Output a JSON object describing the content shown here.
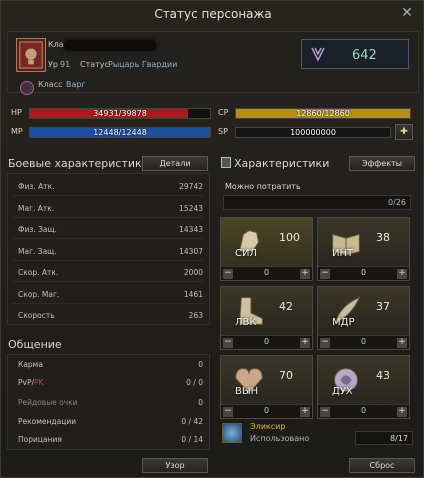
{
  "window": {
    "title": "Статус персонажа"
  },
  "character": {
    "clan_label": "Клан",
    "level_label": "Ур",
    "level": "91",
    "status_label": "Статус",
    "status_value": "Рыцарь Гвардии",
    "class_label": "Класс",
    "class_value": "Варг",
    "power": "642"
  },
  "bars": {
    "hp": {
      "label": "HP",
      "text": "34931/39878",
      "fraction": 0.876,
      "color": "#a41d1d"
    },
    "mp": {
      "label": "MP",
      "text": "12448/12448",
      "fraction": 1.0,
      "color": "#1e4e9e"
    },
    "cp": {
      "label": "CP",
      "text": "12860/12860",
      "fraction": 1.0,
      "color": "#b48d1a"
    },
    "sp": {
      "label": "SP",
      "text": "100000000"
    }
  },
  "combat": {
    "title": "Боевые характеристики",
    "details_button": "Детали",
    "rows": [
      {
        "label": "Физ. Атк.",
        "value": "29742"
      },
      {
        "label": "Маг. Атк.",
        "value": "15243"
      },
      {
        "label": "Физ. Защ.",
        "value": "14343"
      },
      {
        "label": "Маг. Защ.",
        "value": "14307"
      },
      {
        "label": "Скор. Атк.",
        "value": "2000"
      },
      {
        "label": "Скор. Маг.",
        "value": "1461"
      },
      {
        "label": "Скорость",
        "value": "263"
      }
    ]
  },
  "social": {
    "title": "Общение",
    "karma_label": "Карма",
    "karma_value": "0",
    "pvp_label": "PvP/",
    "pk_label": "PK",
    "pvp_value": "0 / 0",
    "raid_label": "Рейдовые очки",
    "raid_value": "0",
    "rec_label": "Рекомендации",
    "rec_value": "0 / 42",
    "cens_label": "Порицания",
    "cens_value": "0 / 14",
    "view_button": "Узор"
  },
  "attributes": {
    "title": "Характеристики",
    "effects_button": "Эффекты",
    "spend_label": "Можно потратить",
    "spend_value": "0/26",
    "stats": [
      {
        "abbr": "СИЛ",
        "value": "100",
        "alloc": "0",
        "icon": "fist-icon"
      },
      {
        "abbr": "ИНТ",
        "value": "38",
        "alloc": "0",
        "icon": "book-icon"
      },
      {
        "abbr": "ЛВК",
        "value": "42",
        "alloc": "0",
        "icon": "boot-icon"
      },
      {
        "abbr": "МДР",
        "value": "37",
        "alloc": "0",
        "icon": "feather-icon"
      },
      {
        "abbr": "ВЫН",
        "value": "70",
        "alloc": "0",
        "icon": "heart-icon"
      },
      {
        "abbr": "ДУХ",
        "value": "43",
        "alloc": "0",
        "icon": "spirit-icon"
      }
    ],
    "elixir_label": "Эликсир",
    "elixir_used_label": "Использовано",
    "elixir_value": "8/17",
    "reset_button": "Сброс"
  },
  "colors": {
    "accent_gold": "#b48d1a",
    "pk_red": "#d03a3a",
    "power_green": "#9fd8b4",
    "status_blue": "#8fb2d6"
  }
}
